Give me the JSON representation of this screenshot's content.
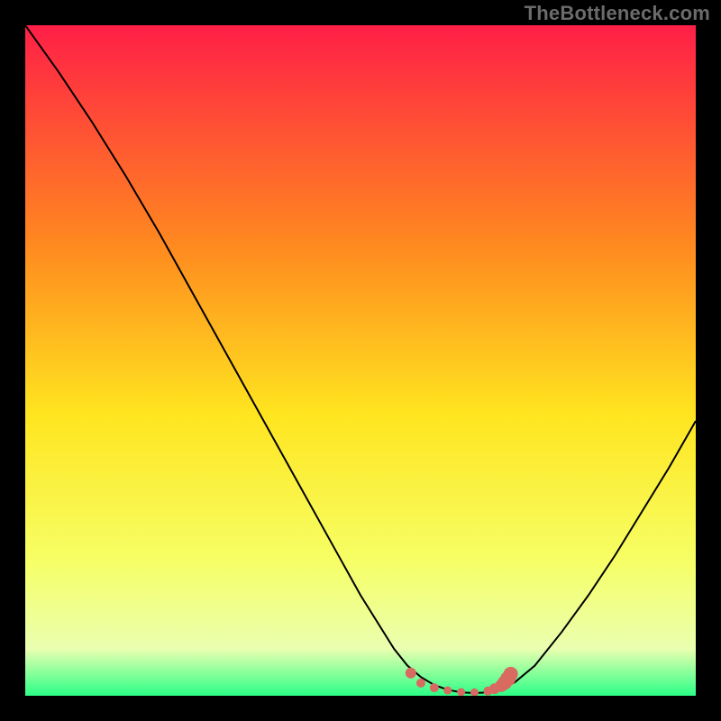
{
  "watermark": "TheBottleneck.com",
  "colors": {
    "bg": "#000000",
    "curve": "#000000",
    "marker": "#d86a62",
    "marker_edge": "#cc5a52",
    "gradient_top": "#ff1f47",
    "gradient_mid_upper": "#ff8a1f",
    "gradient_mid": "#ffe51f",
    "gradient_mid_lower": "#f6ff66",
    "gradient_low": "#eaffb0",
    "gradient_bottom": "#2bff86"
  },
  "chart_data": {
    "type": "line",
    "title": "",
    "xlabel": "",
    "ylabel": "",
    "xlim": [
      0,
      100
    ],
    "ylim": [
      0,
      100
    ],
    "grid": false,
    "legend": false,
    "series": [
      {
        "name": "bottleneck-curve",
        "x": [
          0,
          5,
          10,
          15,
          20,
          25,
          30,
          35,
          40,
          45,
          50,
          55,
          57,
          59,
          61,
          63,
          65,
          67,
          69,
          71,
          73,
          76,
          80,
          84,
          88,
          92,
          96,
          100
        ],
        "y": [
          100,
          93,
          85.5,
          77.5,
          69,
          60,
          51,
          42,
          33,
          24,
          15,
          7,
          4.5,
          2.8,
          1.6,
          0.9,
          0.5,
          0.4,
          0.5,
          1.0,
          2.0,
          4.5,
          9.5,
          15,
          21,
          27.5,
          34,
          41
        ]
      }
    ],
    "markers": [
      {
        "name": "highlight-flat-region",
        "x": [
          57.5,
          59,
          61,
          63,
          65,
          67,
          69,
          70,
          71,
          71.5,
          72,
          72.4
        ],
        "y": [
          3.4,
          1.9,
          1.2,
          0.8,
          0.55,
          0.5,
          0.7,
          1.05,
          1.5,
          1.95,
          2.55,
          3.25
        ],
        "r": [
          6,
          5,
          5,
          4.5,
          4.5,
          4.5,
          5,
          6,
          7,
          8,
          8.5,
          8
        ]
      }
    ]
  }
}
